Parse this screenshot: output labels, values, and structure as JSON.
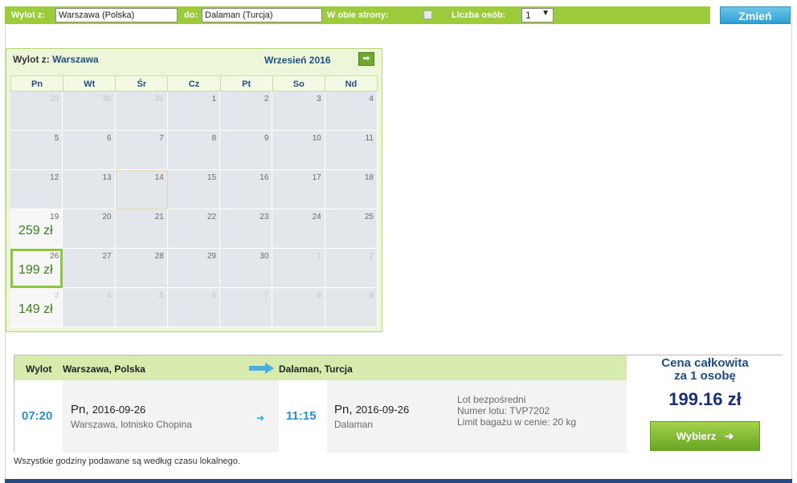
{
  "search": {
    "from_label": "Wylot z:",
    "from_value": "Warszawa (Polska)",
    "to_label": "do:",
    "to_value": "Dalaman (Turcja)",
    "roundtrip_label": "W obie strony:",
    "persons_label": "Liczba osób:",
    "persons_value": "1",
    "change_label": "Zmień"
  },
  "calendar": {
    "header_prefix": "Wylot z:",
    "header_city": "Warszawa",
    "month": "Wrzesień 2016",
    "next_icon": "arrow-right-icon",
    "dow": [
      "Pn",
      "Wt",
      "Śr",
      "Cz",
      "Pt",
      "So",
      "Nd"
    ],
    "weeks": [
      [
        {
          "d": "29",
          "dim": true
        },
        {
          "d": "30",
          "dim": true
        },
        {
          "d": "31",
          "dim": true
        },
        {
          "d": "1"
        },
        {
          "d": "2"
        },
        {
          "d": "3"
        },
        {
          "d": "4"
        }
      ],
      [
        {
          "d": "5"
        },
        {
          "d": "6"
        },
        {
          "d": "7"
        },
        {
          "d": "8"
        },
        {
          "d": "9"
        },
        {
          "d": "10"
        },
        {
          "d": "11"
        }
      ],
      [
        {
          "d": "12"
        },
        {
          "d": "13"
        },
        {
          "d": "14",
          "today": true
        },
        {
          "d": "15"
        },
        {
          "d": "16"
        },
        {
          "d": "17"
        },
        {
          "d": "18"
        }
      ],
      [
        {
          "d": "19",
          "price": "259 zł"
        },
        {
          "d": "20"
        },
        {
          "d": "21"
        },
        {
          "d": "22"
        },
        {
          "d": "23"
        },
        {
          "d": "24"
        },
        {
          "d": "25"
        }
      ],
      [
        {
          "d": "26",
          "price": "199 zł",
          "selected": true
        },
        {
          "d": "27"
        },
        {
          "d": "28"
        },
        {
          "d": "29"
        },
        {
          "d": "30"
        },
        {
          "d": "1",
          "dim": true
        },
        {
          "d": "2",
          "dim": true
        }
      ],
      [
        {
          "d": "3",
          "dim": true,
          "price": "149 zł"
        },
        {
          "d": "4",
          "dim": true
        },
        {
          "d": "5",
          "dim": true
        },
        {
          "d": "6",
          "dim": true
        },
        {
          "d": "7",
          "dim": true
        },
        {
          "d": "8",
          "dim": true
        },
        {
          "d": "9",
          "dim": true
        }
      ]
    ]
  },
  "flight": {
    "dep_label": "Wylot",
    "dep_city": "Warszawa, Polska",
    "arr_city": "Dalaman, Turcja",
    "dep_time": "07:20",
    "dep_day": "Pn,",
    "dep_date": "2016-09-26",
    "dep_place": "Warszawa, lotnisko Chopina",
    "arr_time": "11:15",
    "arr_day": "Pn,",
    "arr_date": "2016-09-26",
    "arr_place": "Dalaman",
    "info1": "Lot bezpośredni",
    "info2": "Numer lotu: TVP7202",
    "info3": "Limit bagażu w cenie: 20 kg",
    "price_label_1": "Cena całkowita",
    "price_label_2": "za 1 osobę",
    "price": "199.16 zł",
    "choose_label": "Wybierz"
  },
  "note": "Wszystkie godziny podawane są według czasu lokalnego."
}
